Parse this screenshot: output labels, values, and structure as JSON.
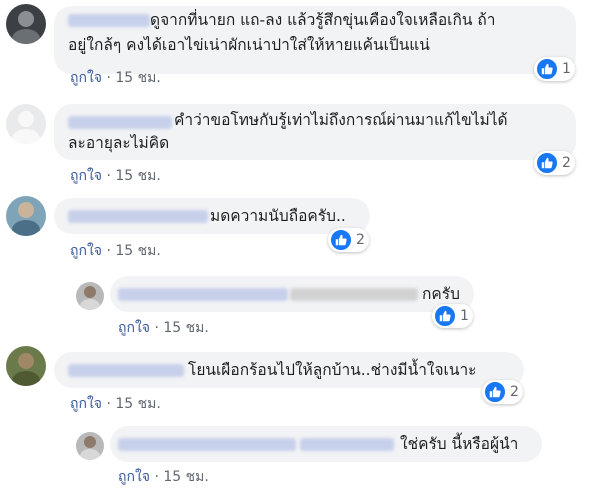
{
  "comments": [
    {
      "text_line1": "ดูจากที่นายก แถ-ลง แล้วรู้สึกขุ่นเคืองใจเหลือเกิน ถ้า",
      "text_line2": "อยู่ใกล้ๆ คงได้เอาไข่เน่าผักเน่าปาใส่ให้หายแค้นเป็นแน่",
      "like_label": "ถูกใจ",
      "time": "15 ชม.",
      "reactions": "1"
    },
    {
      "text_line1": "คำว่าขอโทษกับรู้เท่าไม่ถึงการณ์ผ่านมาแก้ไขไม่ได้",
      "text_line2": "ละอายุละไม่คิด",
      "like_label": "ถูกใจ",
      "time": "15 ชม.",
      "reactions": "2"
    },
    {
      "text_line1": "มดความนับถือครับ..",
      "like_label": "ถูกใจ",
      "time": "15 ชม.",
      "reactions": "2"
    },
    {
      "text_line1": "กครับ",
      "like_label": "ถูกใจ",
      "time": "15 ชม.",
      "reactions": "1"
    },
    {
      "text_line1": "โยนเผือกร้อนไปให้ลูกบ้าน..ช่างมีน้ำใจเนาะ",
      "like_label": "ถูกใจ",
      "time": "15 ชม.",
      "reactions": "2"
    },
    {
      "text_line1": "ใช่ครับ นี้หรือผู้นำ",
      "like_label": "ถูกใจ",
      "time": "15 ชม."
    }
  ],
  "colors": {
    "bubble": "#f2f3f5",
    "like_blue": "#1877f2",
    "link": "#385898",
    "meta": "#606770"
  },
  "icons": {
    "reaction": "like-thumb-icon"
  }
}
